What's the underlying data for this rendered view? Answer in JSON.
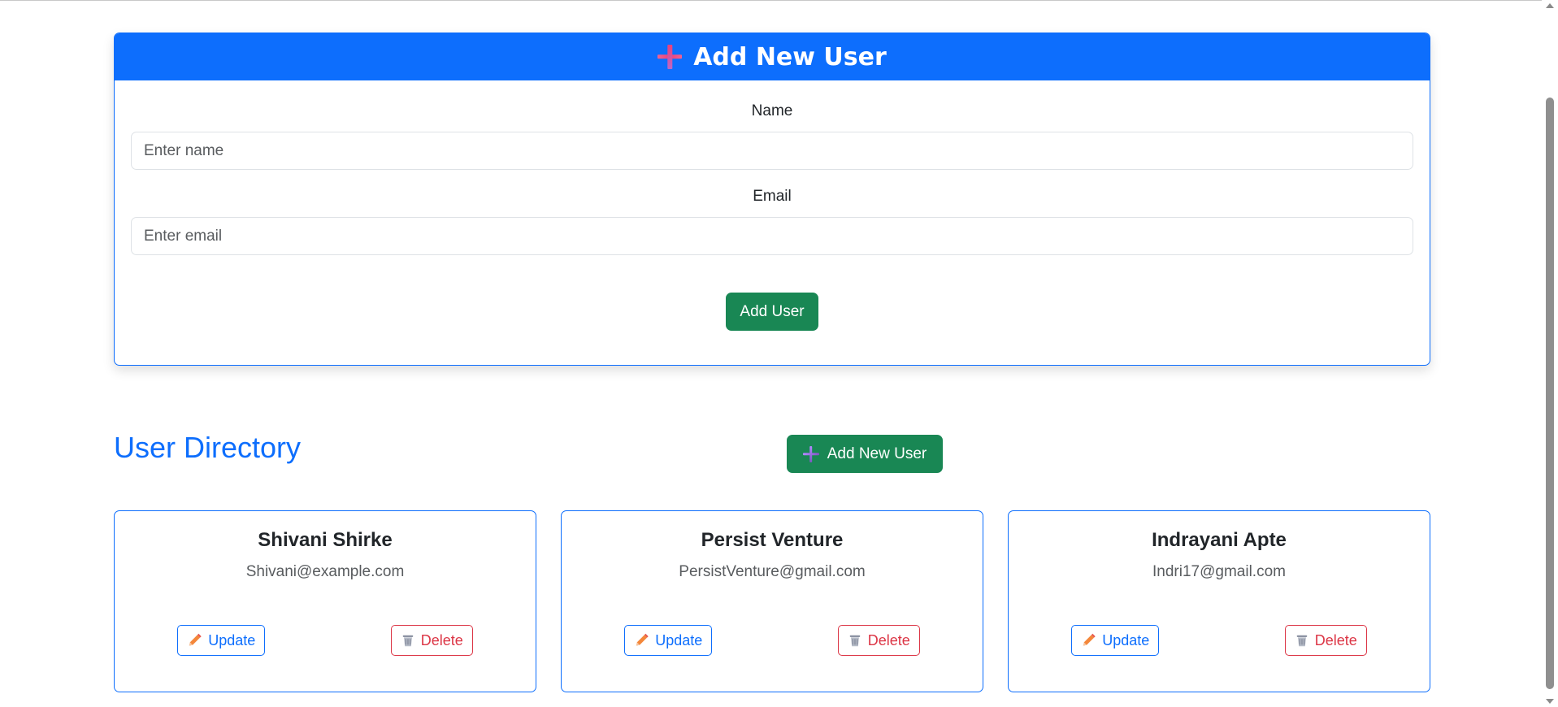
{
  "add_form": {
    "header_title": "Add New User",
    "header_icon": "plus-icon",
    "name_label": "Name",
    "name_placeholder": "Enter name",
    "name_value": "",
    "email_label": "Email",
    "email_placeholder": "Enter email",
    "email_value": "",
    "submit_label": "Add User"
  },
  "directory": {
    "title": "User Directory",
    "add_new_label": "Add New User",
    "add_new_icon": "plus-icon"
  },
  "users": [
    {
      "name": "Shivani Shirke",
      "email": "Shivani@example.com",
      "update_label": "Update",
      "delete_label": "Delete"
    },
    {
      "name": "Persist Venture",
      "email": "PersistVenture@gmail.com",
      "update_label": "Update",
      "delete_label": "Delete"
    },
    {
      "name": "Indrayani Apte",
      "email": "Indri17@gmail.com",
      "update_label": "Update",
      "delete_label": "Delete"
    }
  ],
  "icons": {
    "update": "pencil-icon",
    "delete": "wastebasket-icon"
  },
  "colors": {
    "primary": "#0d6efd",
    "success": "#198754",
    "danger": "#dc3545",
    "text": "#212529",
    "muted": "#595c5f"
  }
}
